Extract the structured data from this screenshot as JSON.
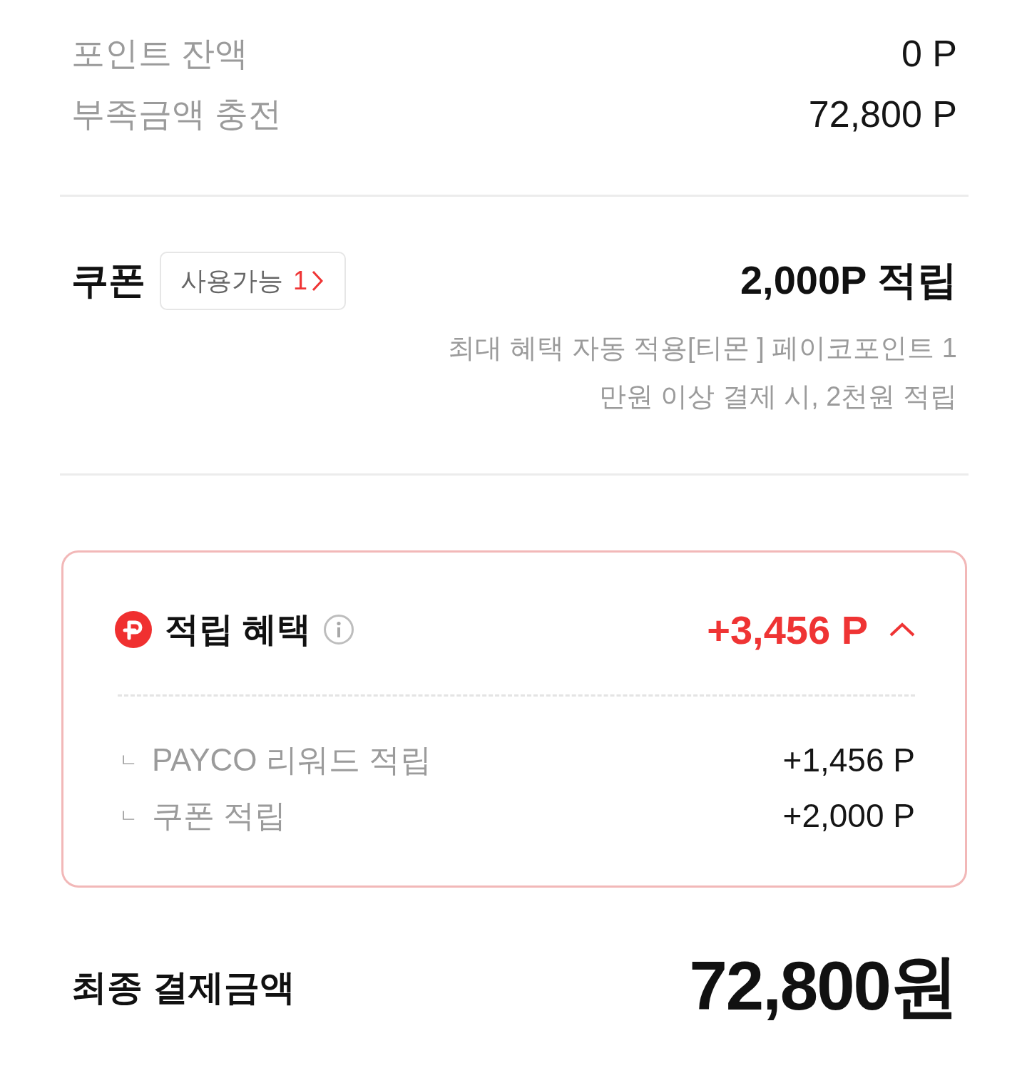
{
  "balance_rows": [
    {
      "label": "포인트 잔액",
      "value": "0 P"
    },
    {
      "label": "부족금액 충전",
      "value": "72,800 P"
    }
  ],
  "coupon": {
    "title": "쿠폰",
    "available_button": {
      "label": "사용가능",
      "count": "1"
    },
    "reward": "2,000P 적립",
    "description": "최대 혜택 자동 적용[티몬 ] 페이코포인트 1만원 이상 결제 시, 2천원 적립"
  },
  "benefits": {
    "title": "적립 혜택",
    "total": "+3,456 P",
    "expanded": true,
    "items": [
      {
        "marker": "ㄴ",
        "label": "PAYCO 리워드 적립",
        "value": "+1,456 P"
      },
      {
        "marker": "ㄴ",
        "label": "쿠폰 적립",
        "value": "+2,000 P"
      }
    ]
  },
  "final_payment": {
    "label": "최종 결제금액",
    "amount": "72,800원"
  }
}
